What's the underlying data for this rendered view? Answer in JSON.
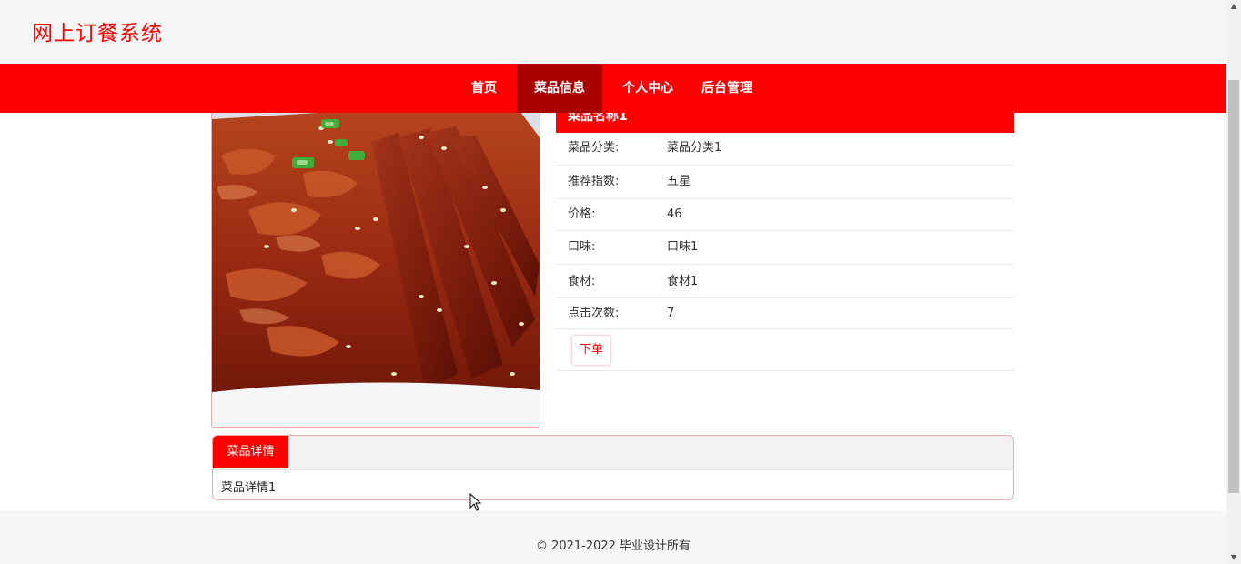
{
  "header": {
    "site_title": "网上订餐系统"
  },
  "nav": {
    "items": [
      {
        "label": "首页",
        "active": false
      },
      {
        "label": "菜品信息",
        "active": true
      },
      {
        "label": "个人中心",
        "active": false
      },
      {
        "label": "后台管理",
        "active": false
      }
    ]
  },
  "dish": {
    "name": "菜品名称1",
    "fields": [
      {
        "label": "菜品分类:",
        "value": "菜品分类1"
      },
      {
        "label": "推荐指数:",
        "value": "五星"
      },
      {
        "label": "价格:",
        "value": "46"
      },
      {
        "label": "口味:",
        "value": "口味1"
      },
      {
        "label": "食材:",
        "value": "食材1"
      },
      {
        "label": "点击次数:",
        "value": "7"
      }
    ],
    "order_button": "下单"
  },
  "details": {
    "tab_label": "菜品详情",
    "content": "菜品详情1"
  },
  "footer": {
    "copyright": "© 2021-2022 毕业设计所有"
  },
  "colors": {
    "brand_red": "#ff0000",
    "nav_active": "#a80000",
    "header_bg": "#f6f6f6"
  }
}
